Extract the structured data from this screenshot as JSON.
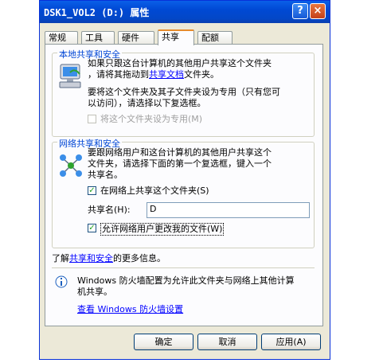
{
  "window": {
    "title": "DSK1_VOL2 (D:) 属性",
    "help_label": "?",
    "close_label": "×"
  },
  "tabs": [
    {
      "label": "常规"
    },
    {
      "label": "工具"
    },
    {
      "label": "硬件"
    },
    {
      "label": "共享"
    },
    {
      "label": "配额"
    }
  ],
  "local": {
    "title": "本地共享和安全",
    "line1a": "如果只跟这台计算机的其他用户共享这个文件夹",
    "line1b_pre": "，请将其拖动到",
    "line1b_link": "共享文档",
    "line1b_post": "文件夹。",
    "line2": "要将这个文件夹及其子文件夹设为专用（只有您可",
    "line3": "以访问），请选择以下复选框。",
    "private_label": "将这个文件夹设为专用(M)",
    "private_checked": false
  },
  "network": {
    "title": "网络共享和安全",
    "line1": "要跟网络用户和这台计算机的其他用户共享这个",
    "line2": "文件夹，请选择下面的第一个复选框，键入一个",
    "line3": "共享名。",
    "share_label": "在网络上共享这个文件夹(S)",
    "share_checked": true,
    "share_name_label": "共享名(H):",
    "share_name_value": "D",
    "allow_label": "允许网络用户更改我的文件(W)",
    "allow_checked": true,
    "learn_pre": "了解",
    "learn_link": "共享和安全",
    "learn_post": "的更多信息。"
  },
  "firewall": {
    "line1": "Windows 防火墙配置为允许此文件夹与网络上其他计算",
    "line2": "机共享。",
    "link": "查看 Windows 防火墙设置"
  },
  "buttons": {
    "ok": "确定",
    "cancel": "取消",
    "apply": "应用(A)"
  },
  "icons": [
    "help-icon",
    "close-icon",
    "computer-icon",
    "network-users-icon",
    "info-icon"
  ],
  "colors": {
    "titlebar": "#0553dd",
    "group_label": "#0046d5",
    "link": "#0000ff",
    "check": "#21a121"
  }
}
